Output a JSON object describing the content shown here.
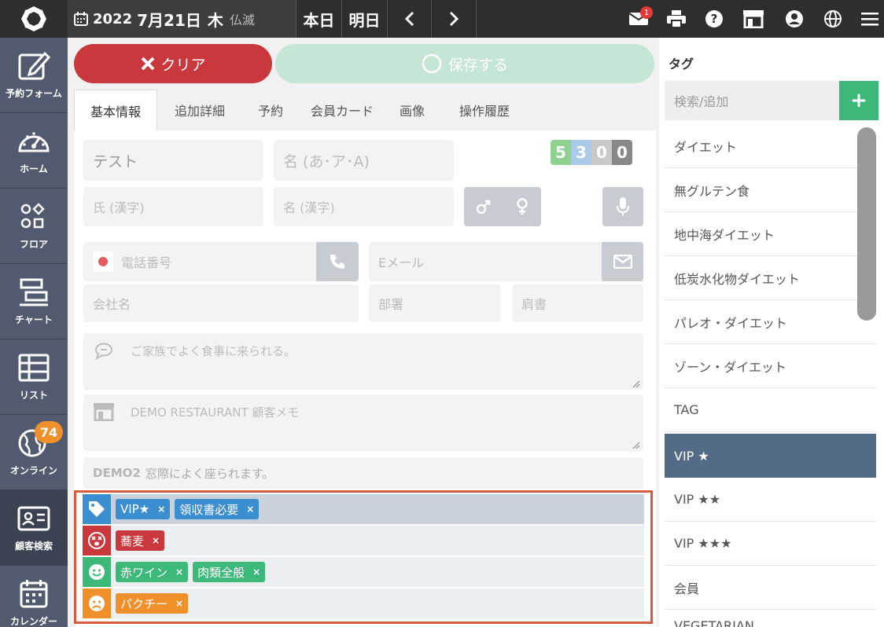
{
  "header": {
    "year": "2022",
    "month_day": "7月21日",
    "weekday": "木",
    "rokuyo": "仏滅",
    "today_label": "本日",
    "tomorrow_label": "明日",
    "mail_badge": "1"
  },
  "sidebar": {
    "items": [
      {
        "label": "予約フォーム",
        "icon": "edit-icon"
      },
      {
        "label": "ホーム",
        "icon": "gauge-icon"
      },
      {
        "label": "フロア",
        "icon": "floor-icon"
      },
      {
        "label": "チャート",
        "icon": "chart-icon"
      },
      {
        "label": "リスト",
        "icon": "list-icon"
      },
      {
        "label": "オンライン",
        "icon": "globe-icon",
        "badge": "74"
      },
      {
        "label": "顧客検索",
        "icon": "id-card-icon"
      },
      {
        "label": "カレンダー",
        "icon": "calendar-icon"
      }
    ]
  },
  "toolbar": {
    "clear_label": "クリア",
    "save_label": "保存する"
  },
  "tabs": [
    {
      "label": "基本情報"
    },
    {
      "label": "追加詳細"
    },
    {
      "label": "予約"
    },
    {
      "label": "会員カード"
    },
    {
      "label": "画像"
    },
    {
      "label": "操作履歴"
    }
  ],
  "form": {
    "last_name_kana_value": "テスト",
    "first_name_kana_placeholder": "名 (あ･ア･A)",
    "last_name_kanji_placeholder": "氏 (漢字)",
    "first_name_kanji_placeholder": "名 (漢字)",
    "phone_placeholder": "電話番号",
    "email_placeholder": "Eメール",
    "company_placeholder": "会社名",
    "department_placeholder": "部署",
    "title_placeholder": "肩書",
    "note_value": "ご家族でよく食事に来られる。",
    "restaurant_memo_placeholder": "DEMO RESTAURANT 顧客メモ",
    "demo2_label": "DEMO2",
    "demo2_value": "窓際によく座られます。"
  },
  "counter": [
    {
      "value": "5",
      "color": "#8fd18f"
    },
    {
      "value": "3",
      "color": "#a9cbe8"
    },
    {
      "value": "0",
      "color": "#c9c9c9"
    },
    {
      "value": "0",
      "color": "#888888"
    }
  ],
  "tag_rows": [
    {
      "icon": "tag-icon",
      "color": "#3b8fd1",
      "chips": [
        "VIP★",
        "領収書必要"
      ]
    },
    {
      "icon": "dizzy-face-icon",
      "color": "#c9383d",
      "chips": [
        "蕎麦"
      ]
    },
    {
      "icon": "smile-face-icon",
      "color": "#3cb878",
      "chips": [
        "赤ワイン",
        "肉類全般"
      ]
    },
    {
      "icon": "frown-face-icon",
      "color": "#f0902a",
      "chips": [
        "パクチー"
      ]
    }
  ],
  "chip_remove": "×",
  "tag_panel": {
    "title": "タグ",
    "search_placeholder": "検索/追加",
    "add_label": "+",
    "items": [
      {
        "label": "ダイエット"
      },
      {
        "label": "無グルテン食"
      },
      {
        "label": "地中海ダイエット"
      },
      {
        "label": "低炭水化物ダイエット"
      },
      {
        "label": "パレオ・ダイエット"
      },
      {
        "label": "ゾーン・ダイエット"
      },
      {
        "label": "TAG"
      },
      {
        "label": "VIP ★",
        "selected": true
      },
      {
        "label": "VIP ★★"
      },
      {
        "label": "VIP ★★★"
      },
      {
        "label": "会員"
      },
      {
        "label": "VEGETARIAN"
      }
    ]
  }
}
